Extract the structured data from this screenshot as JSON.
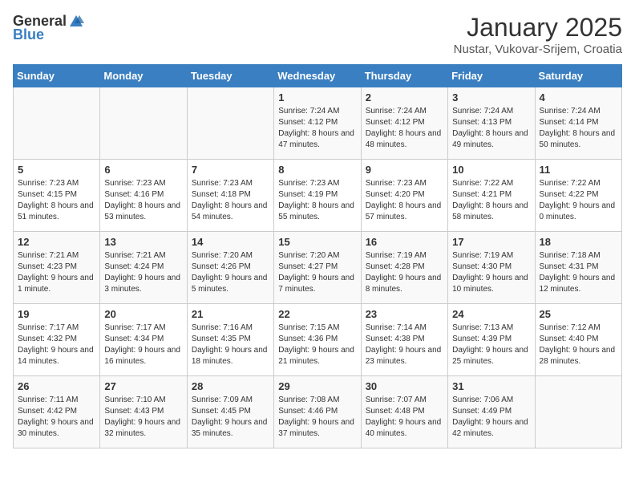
{
  "header": {
    "logo_general": "General",
    "logo_blue": "Blue",
    "month_title": "January 2025",
    "location": "Nustar, Vukovar-Srijem, Croatia"
  },
  "days_of_week": [
    "Sunday",
    "Monday",
    "Tuesday",
    "Wednesday",
    "Thursday",
    "Friday",
    "Saturday"
  ],
  "weeks": [
    [
      {
        "day": "",
        "info": ""
      },
      {
        "day": "",
        "info": ""
      },
      {
        "day": "",
        "info": ""
      },
      {
        "day": "1",
        "info": "Sunrise: 7:24 AM\nSunset: 4:12 PM\nDaylight: 8 hours and 47 minutes."
      },
      {
        "day": "2",
        "info": "Sunrise: 7:24 AM\nSunset: 4:12 PM\nDaylight: 8 hours and 48 minutes."
      },
      {
        "day": "3",
        "info": "Sunrise: 7:24 AM\nSunset: 4:13 PM\nDaylight: 8 hours and 49 minutes."
      },
      {
        "day": "4",
        "info": "Sunrise: 7:24 AM\nSunset: 4:14 PM\nDaylight: 8 hours and 50 minutes."
      }
    ],
    [
      {
        "day": "5",
        "info": "Sunrise: 7:23 AM\nSunset: 4:15 PM\nDaylight: 8 hours and 51 minutes."
      },
      {
        "day": "6",
        "info": "Sunrise: 7:23 AM\nSunset: 4:16 PM\nDaylight: 8 hours and 53 minutes."
      },
      {
        "day": "7",
        "info": "Sunrise: 7:23 AM\nSunset: 4:18 PM\nDaylight: 8 hours and 54 minutes."
      },
      {
        "day": "8",
        "info": "Sunrise: 7:23 AM\nSunset: 4:19 PM\nDaylight: 8 hours and 55 minutes."
      },
      {
        "day": "9",
        "info": "Sunrise: 7:23 AM\nSunset: 4:20 PM\nDaylight: 8 hours and 57 minutes."
      },
      {
        "day": "10",
        "info": "Sunrise: 7:22 AM\nSunset: 4:21 PM\nDaylight: 8 hours and 58 minutes."
      },
      {
        "day": "11",
        "info": "Sunrise: 7:22 AM\nSunset: 4:22 PM\nDaylight: 9 hours and 0 minutes."
      }
    ],
    [
      {
        "day": "12",
        "info": "Sunrise: 7:21 AM\nSunset: 4:23 PM\nDaylight: 9 hours and 1 minute."
      },
      {
        "day": "13",
        "info": "Sunrise: 7:21 AM\nSunset: 4:24 PM\nDaylight: 9 hours and 3 minutes."
      },
      {
        "day": "14",
        "info": "Sunrise: 7:20 AM\nSunset: 4:26 PM\nDaylight: 9 hours and 5 minutes."
      },
      {
        "day": "15",
        "info": "Sunrise: 7:20 AM\nSunset: 4:27 PM\nDaylight: 9 hours and 7 minutes."
      },
      {
        "day": "16",
        "info": "Sunrise: 7:19 AM\nSunset: 4:28 PM\nDaylight: 9 hours and 8 minutes."
      },
      {
        "day": "17",
        "info": "Sunrise: 7:19 AM\nSunset: 4:30 PM\nDaylight: 9 hours and 10 minutes."
      },
      {
        "day": "18",
        "info": "Sunrise: 7:18 AM\nSunset: 4:31 PM\nDaylight: 9 hours and 12 minutes."
      }
    ],
    [
      {
        "day": "19",
        "info": "Sunrise: 7:17 AM\nSunset: 4:32 PM\nDaylight: 9 hours and 14 minutes."
      },
      {
        "day": "20",
        "info": "Sunrise: 7:17 AM\nSunset: 4:34 PM\nDaylight: 9 hours and 16 minutes."
      },
      {
        "day": "21",
        "info": "Sunrise: 7:16 AM\nSunset: 4:35 PM\nDaylight: 9 hours and 18 minutes."
      },
      {
        "day": "22",
        "info": "Sunrise: 7:15 AM\nSunset: 4:36 PM\nDaylight: 9 hours and 21 minutes."
      },
      {
        "day": "23",
        "info": "Sunrise: 7:14 AM\nSunset: 4:38 PM\nDaylight: 9 hours and 23 minutes."
      },
      {
        "day": "24",
        "info": "Sunrise: 7:13 AM\nSunset: 4:39 PM\nDaylight: 9 hours and 25 minutes."
      },
      {
        "day": "25",
        "info": "Sunrise: 7:12 AM\nSunset: 4:40 PM\nDaylight: 9 hours and 28 minutes."
      }
    ],
    [
      {
        "day": "26",
        "info": "Sunrise: 7:11 AM\nSunset: 4:42 PM\nDaylight: 9 hours and 30 minutes."
      },
      {
        "day": "27",
        "info": "Sunrise: 7:10 AM\nSunset: 4:43 PM\nDaylight: 9 hours and 32 minutes."
      },
      {
        "day": "28",
        "info": "Sunrise: 7:09 AM\nSunset: 4:45 PM\nDaylight: 9 hours and 35 minutes."
      },
      {
        "day": "29",
        "info": "Sunrise: 7:08 AM\nSunset: 4:46 PM\nDaylight: 9 hours and 37 minutes."
      },
      {
        "day": "30",
        "info": "Sunrise: 7:07 AM\nSunset: 4:48 PM\nDaylight: 9 hours and 40 minutes."
      },
      {
        "day": "31",
        "info": "Sunrise: 7:06 AM\nSunset: 4:49 PM\nDaylight: 9 hours and 42 minutes."
      },
      {
        "day": "",
        "info": ""
      }
    ]
  ]
}
